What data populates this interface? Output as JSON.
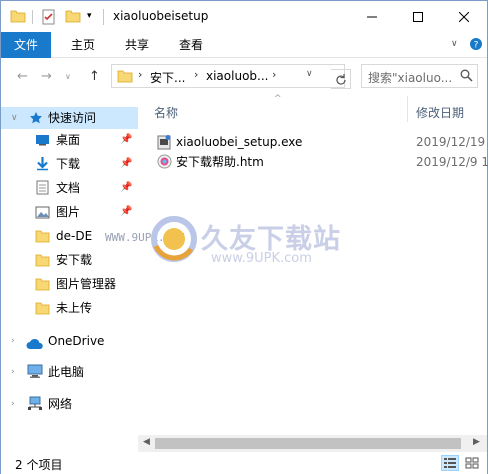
{
  "window": {
    "title": "xiaoluobeisetup"
  },
  "ribbon": {
    "tabs": [
      "文件",
      "主页",
      "共享",
      "查看"
    ]
  },
  "address": {
    "crumbs": [
      "安下...",
      "xiaoluob..."
    ],
    "search_placeholder": "搜索\"xiaoluo..."
  },
  "nav": {
    "quick_access": "快速访问",
    "items": [
      {
        "label": "桌面",
        "icon": "desktop-icon",
        "pinned": true
      },
      {
        "label": "下载",
        "icon": "download-icon",
        "pinned": true
      },
      {
        "label": "文档",
        "icon": "document-icon",
        "pinned": true
      },
      {
        "label": "图片",
        "icon": "pictures-icon",
        "pinned": true
      },
      {
        "label": "de-DE",
        "icon": "folder-icon",
        "pinned": false
      },
      {
        "label": "安下载",
        "icon": "folder-icon",
        "pinned": false
      },
      {
        "label": "图片管理器",
        "icon": "folder-icon",
        "pinned": false
      },
      {
        "label": "未上传",
        "icon": "folder-icon",
        "pinned": false
      }
    ],
    "onedrive": "OneDrive",
    "this_pc": "此电脑",
    "network": "网络"
  },
  "columns": {
    "name": "名称",
    "modified": "修改日期"
  },
  "files": [
    {
      "name": "xiaoluobei_setup.exe",
      "date": "2019/12/19",
      "icon": "exe-icon"
    },
    {
      "name": "安下载帮助.htm",
      "date": "2019/12/9 1",
      "icon": "htm-icon"
    }
  ],
  "watermark": {
    "title": "久友下载站",
    "url": "www.9UPK.com",
    "url_left": "WWW.9UPK.COM"
  },
  "status": {
    "item_count": "2 个项目"
  },
  "colors": {
    "accent": "#1979ca",
    "selected": "#cce8ff",
    "folder": "#f8d775"
  }
}
